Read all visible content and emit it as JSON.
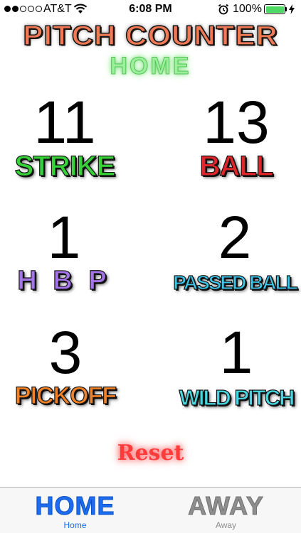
{
  "status_bar": {
    "carrier": "AT&T",
    "time": "6:08 PM",
    "battery_percent": "100%",
    "signal_bars_filled": 2,
    "signal_bars_total": 5
  },
  "title": "PITCH COUNTER",
  "team_banner": "HOME",
  "counters": [
    {
      "count": "11",
      "label": "STRIKE",
      "color": "#38d13a"
    },
    {
      "count": "13",
      "label": "BALL",
      "color": "#e0262a"
    },
    {
      "count": "1",
      "label": "H B P",
      "color": "#a473e8"
    },
    {
      "count": "2",
      "label": "PASSED BALL",
      "color": "#3ec6ea"
    },
    {
      "count": "3",
      "label": "PICKOFF",
      "color": "#f28228"
    },
    {
      "count": "1",
      "label": "WILD PITCH",
      "color": "#45d8e0"
    }
  ],
  "reset_label": "Reset",
  "tab_bar": {
    "tabs": [
      {
        "icon_text": "HOME",
        "caption": "Home",
        "selected": true,
        "color": "#1e6cf0"
      },
      {
        "icon_text": "AWAY",
        "caption": "Away",
        "selected": false,
        "color": "#8e8e8e"
      }
    ]
  },
  "colors": {
    "title": "#f07a55",
    "banner": "#9cef9c",
    "reset": "#ff3b3b",
    "battery": "#4cd964"
  }
}
